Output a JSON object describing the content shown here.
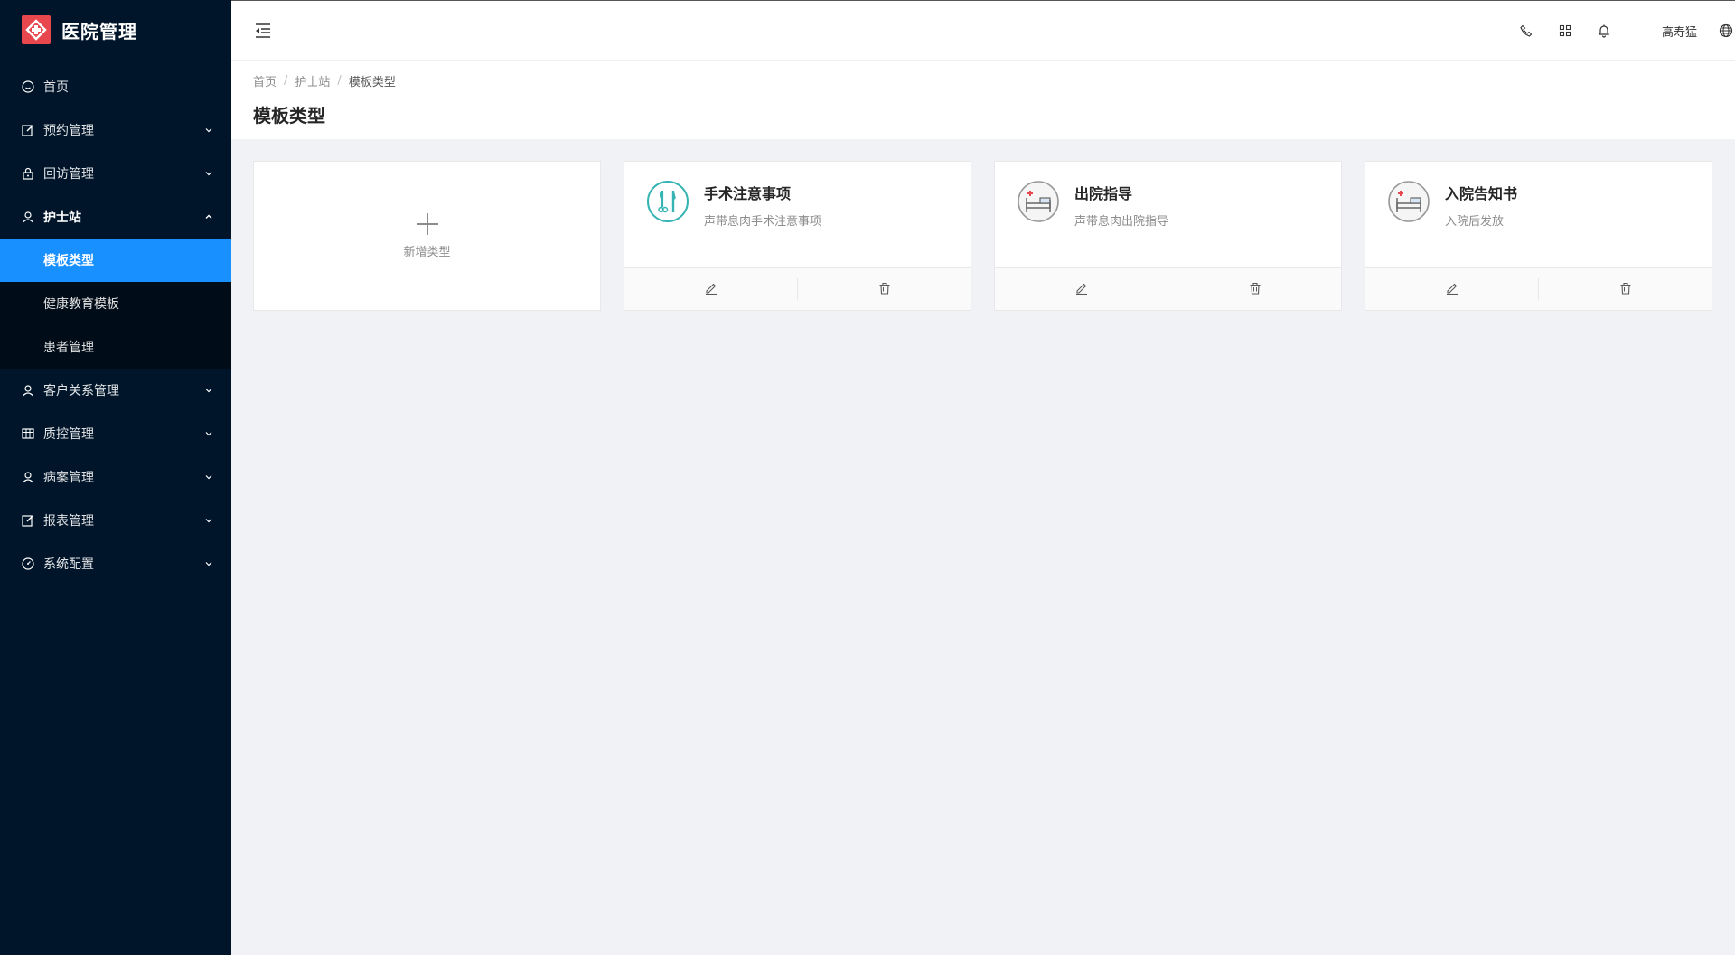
{
  "app": {
    "title": "医院管理"
  },
  "sidebar": {
    "items": [
      {
        "label": "首页"
      },
      {
        "label": "预约管理"
      },
      {
        "label": "回访管理"
      },
      {
        "label": "护士站",
        "children": [
          "模板类型",
          "健康教育模板",
          "患者管理"
        ],
        "active_child": "模板类型"
      },
      {
        "label": "客户关系管理"
      },
      {
        "label": "质控管理"
      },
      {
        "label": "病案管理"
      },
      {
        "label": "报表管理"
      },
      {
        "label": "系统配置"
      }
    ]
  },
  "header": {
    "user_name": "高寿猛",
    "icons": [
      "menu-fold-icon",
      "phone-icon",
      "apps-icon",
      "bell-icon",
      "globe-icon"
    ]
  },
  "page": {
    "breadcrumb": [
      "首页",
      "护士站",
      "模板类型"
    ],
    "title": "模板类型"
  },
  "cards": {
    "add_label": "新增类型",
    "items": [
      {
        "title": "手术注意事项",
        "description": "声带息肉手术注意事项",
        "icon": "surgery-tools-icon"
      },
      {
        "title": "出院指导",
        "description": "声带息肉出院指导",
        "icon": "hospital-bed-icon"
      },
      {
        "title": "入院告知书",
        "description": "入院后发放",
        "icon": "hospital-bed-icon"
      }
    ],
    "actions": [
      "edit-icon",
      "delete-icon"
    ]
  },
  "colors": {
    "sidebar_bg": "#001529",
    "submenu_bg": "#000c17",
    "active": "#1890ff",
    "logo": "#e8484d",
    "page_bg": "#f0f2f5"
  }
}
